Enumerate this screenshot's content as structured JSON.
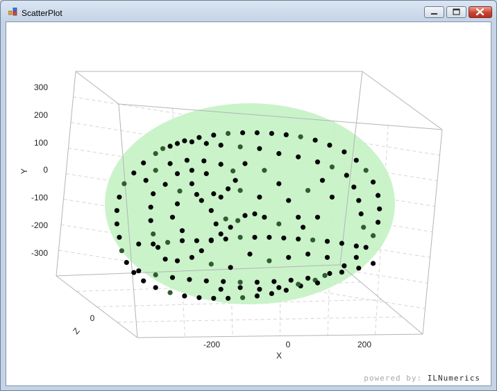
{
  "window": {
    "title": "ScatterPlot",
    "minimize_label": "minimize",
    "maximize_label": "maximize",
    "close_label": "close"
  },
  "footer": {
    "powered_by": "powered by:",
    "brand": "ILNumerics"
  },
  "colors": {
    "sphere_fill": "#c4f2c4",
    "point_dark": "#050505",
    "point_light": "#2f5d2f",
    "box_line": "#b4b4b4",
    "grid_line": "#d4d4d4"
  },
  "chart_data": {
    "type": "scatter",
    "dimensions": 3,
    "title": "",
    "xlabel": "X",
    "ylabel": "Y",
    "zlabel": "Z",
    "x_ticks": [
      "-200",
      "0",
      "200"
    ],
    "y_ticks": [
      "300",
      "200",
      "100",
      "0",
      "-100",
      "-200",
      "-300"
    ],
    "z_ticks": [
      "0"
    ],
    "xlim": [
      -350,
      300
    ],
    "ylim": [
      -350,
      350
    ],
    "surface": "translucent sphere",
    "grid": true,
    "legend": "none",
    "series": [
      {
        "marker": "filled circle",
        "points": [
          [
            -260,
            60,
            0
          ],
          [
            -270,
            20,
            0
          ],
          [
            -275,
            -20,
            0
          ],
          [
            -275,
            -60,
            0
          ],
          [
            -270,
            -100,
            0
          ],
          [
            -265,
            -140,
            0
          ],
          [
            -255,
            -175,
            0
          ],
          [
            -240,
            -205,
            0
          ],
          [
            -220,
            -230,
            0
          ],
          [
            -195,
            -250,
            0
          ],
          [
            -165,
            -265,
            0
          ],
          [
            -135,
            -275,
            0
          ],
          [
            -105,
            -280,
            0
          ],
          [
            -75,
            -282,
            0
          ],
          [
            -45,
            -282,
            0
          ],
          [
            -15,
            -280,
            0
          ],
          [
            15,
            -275,
            0
          ],
          [
            45,
            -268,
            0
          ],
          [
            75,
            -258,
            0
          ],
          [
            105,
            -245,
            0
          ],
          [
            135,
            -228,
            0
          ],
          [
            165,
            -208,
            0
          ],
          [
            195,
            -185,
            0
          ],
          [
            220,
            -160,
            0
          ],
          [
            240,
            -130,
            0
          ],
          [
            255,
            -95,
            0
          ],
          [
            265,
            -55,
            0
          ],
          [
            268,
            -15,
            0
          ],
          [
            265,
            25,
            0
          ],
          [
            255,
            65,
            0
          ],
          [
            240,
            100,
            0
          ],
          [
            220,
            130,
            0
          ],
          [
            195,
            155,
            0
          ],
          [
            165,
            175,
            0
          ],
          [
            135,
            190,
            0
          ],
          [
            105,
            200,
            0
          ],
          [
            75,
            206,
            0
          ],
          [
            45,
            210,
            0
          ],
          [
            15,
            212,
            0
          ],
          [
            -15,
            212,
            0
          ],
          [
            -45,
            210,
            0
          ],
          [
            -75,
            205,
            0
          ],
          [
            -105,
            198,
            0
          ],
          [
            -135,
            188,
            0
          ],
          [
            -165,
            172,
            0
          ],
          [
            -195,
            150,
            0
          ],
          [
            -220,
            122,
            0
          ],
          [
            -240,
            92,
            0
          ],
          [
            -230,
            -120,
            0
          ],
          [
            -200,
            -120,
            0
          ],
          [
            -170,
            -115,
            0
          ],
          [
            -140,
            -110,
            0
          ],
          [
            -110,
            -110,
            0
          ],
          [
            -80,
            -108,
            0
          ],
          [
            -50,
            -105,
            0
          ],
          [
            -20,
            -100,
            0
          ],
          [
            10,
            -100,
            0
          ],
          [
            40,
            -100,
            0
          ],
          [
            70,
            -102,
            0
          ],
          [
            100,
            -105,
            0
          ],
          [
            130,
            -108,
            0
          ],
          [
            160,
            -112,
            0
          ],
          [
            190,
            -118,
            0
          ],
          [
            220,
            -126,
            0
          ],
          [
            -230,
            -200,
            0
          ],
          [
            -195,
            -212,
            0
          ],
          [
            -160,
            -220,
            0
          ],
          [
            -125,
            -226,
            0
          ],
          [
            -90,
            -230,
            0
          ],
          [
            -55,
            -232,
            0
          ],
          [
            -20,
            -234,
            0
          ],
          [
            15,
            -234,
            0
          ],
          [
            50,
            -232,
            0
          ],
          [
            85,
            -228,
            0
          ],
          [
            120,
            -222,
            0
          ],
          [
            155,
            -214,
            0
          ],
          [
            190,
            -204,
            0
          ],
          [
            225,
            -192,
            0
          ],
          [
            255,
            -178,
            0
          ],
          [
            -215,
            70,
            0
          ],
          [
            -195,
            100,
            0
          ],
          [
            -165,
            120,
            0
          ],
          [
            -130,
            130,
            0
          ],
          [
            -95,
            128,
            0
          ],
          [
            -60,
            118,
            0
          ],
          [
            -35,
            98,
            0
          ],
          [
            -30,
            70,
            0
          ],
          [
            -45,
            45,
            0
          ],
          [
            -75,
            30,
            0
          ],
          [
            -110,
            28,
            0
          ],
          [
            -145,
            38,
            0
          ],
          [
            -175,
            58,
            0
          ],
          [
            -200,
            30,
            0
          ],
          [
            -205,
            -10,
            0
          ],
          [
            -205,
            -50,
            0
          ],
          [
            -200,
            -90,
            0
          ],
          [
            -190,
            -130,
            0
          ],
          [
            -175,
            -165,
            0
          ],
          [
            -60,
            -90,
            0
          ],
          [
            -40,
            -70,
            0
          ],
          [
            -25,
            -50,
            0
          ],
          [
            -10,
            -35,
            0
          ],
          [
            10,
            -30,
            0
          ],
          [
            30,
            -40,
            0
          ],
          [
            -70,
            -60,
            0
          ],
          [
            -50,
            -45,
            0
          ],
          [
            -80,
            -110,
            0
          ],
          [
            -100,
            -140,
            0
          ],
          [
            -120,
            -160,
            0
          ],
          [
            -150,
            -170,
            0
          ],
          [
            -180,
            165,
            0
          ],
          [
            -150,
            180,
            0
          ],
          [
            -120,
            185,
            0
          ],
          [
            -90,
            180,
            0
          ],
          [
            -60,
            175,
            0
          ],
          [
            -20,
            170,
            0
          ],
          [
            20,
            165,
            0
          ],
          [
            60,
            150,
            0
          ],
          [
            100,
            140,
            0
          ],
          [
            140,
            125,
            0
          ],
          [
            170,
            110,
            0
          ],
          [
            200,
            85,
            0
          ],
          [
            215,
            50,
            0
          ],
          [
            225,
            10,
            0
          ],
          [
            230,
            -30,
            0
          ],
          [
            235,
            -70,
            0
          ],
          [
            -120,
            60,
            0
          ],
          [
            -100,
            10,
            0
          ],
          [
            -80,
            -20,
            0
          ],
          [
            -60,
            20,
            0
          ],
          [
            -20,
            40,
            0
          ],
          [
            20,
            20,
            0
          ],
          [
            60,
            60,
            0
          ],
          [
            80,
            10,
            0
          ],
          [
            100,
            -40,
            0
          ],
          [
            120,
            40,
            0
          ],
          [
            150,
            70,
            0
          ],
          [
            170,
            20,
            0
          ],
          [
            140,
            -40,
            0
          ],
          [
            110,
            -70,
            0
          ],
          [
            60,
            -60,
            0
          ],
          [
            -150,
            0,
            0
          ],
          [
            -160,
            -40,
            0
          ],
          [
            -140,
            -80,
            0
          ],
          [
            -10,
            120,
            0
          ],
          [
            30,
            100,
            0
          ],
          [
            -90,
            90,
            0
          ],
          [
            -120,
            100,
            0
          ],
          [
            -150,
            90,
            0
          ],
          [
            0,
            -150,
            0
          ],
          [
            40,
            -170,
            0
          ],
          [
            80,
            -160,
            0
          ],
          [
            120,
            -150,
            0
          ],
          [
            160,
            -160,
            0
          ],
          [
            -40,
            -190,
            0
          ],
          [
            -80,
            -180,
            0
          ],
          [
            -20,
            -250,
            0
          ],
          [
            -60,
            -255,
            0
          ],
          [
            20,
            -255,
            0
          ],
          [
            60,
            -250,
            0
          ],
          [
            100,
            -240,
            0
          ],
          [
            140,
            -236,
            0
          ]
        ]
      }
    ]
  }
}
